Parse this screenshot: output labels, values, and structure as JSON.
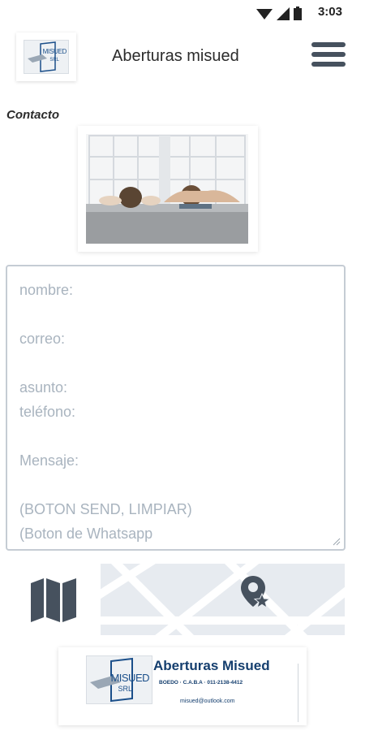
{
  "status_bar": {
    "time": "3:03"
  },
  "header": {
    "logo_text": "MISUED",
    "logo_sub": "SRL",
    "title": "Aberturas misued"
  },
  "section": {
    "label": "Contacto"
  },
  "form": {
    "lines": [
      "nombre:",
      "",
      "correo:",
      "",
      "asunto:",
      "teléfono:",
      "",
      "Mensaje:",
      "",
      "(BOTON SEND, LIMPIAR)",
      "(Boton de Whatsapp"
    ]
  },
  "business_card": {
    "logo_text": "MISUED",
    "logo_sub": "SRL",
    "title": "Aberturas Misued",
    "subtitle": "BOEDO · C.A.B.A · 011-2138-4412",
    "email": "misued@outlook.com"
  },
  "colors": {
    "icon_dark": "#46515e",
    "placeholder_text": "#a9b4bf",
    "brand_blue": "#143e6e"
  },
  "icons": [
    "wifi-icon",
    "cell-signal-icon",
    "battery-icon",
    "hamburger-menu-icon",
    "map-icon",
    "location-pin-star-icon"
  ]
}
